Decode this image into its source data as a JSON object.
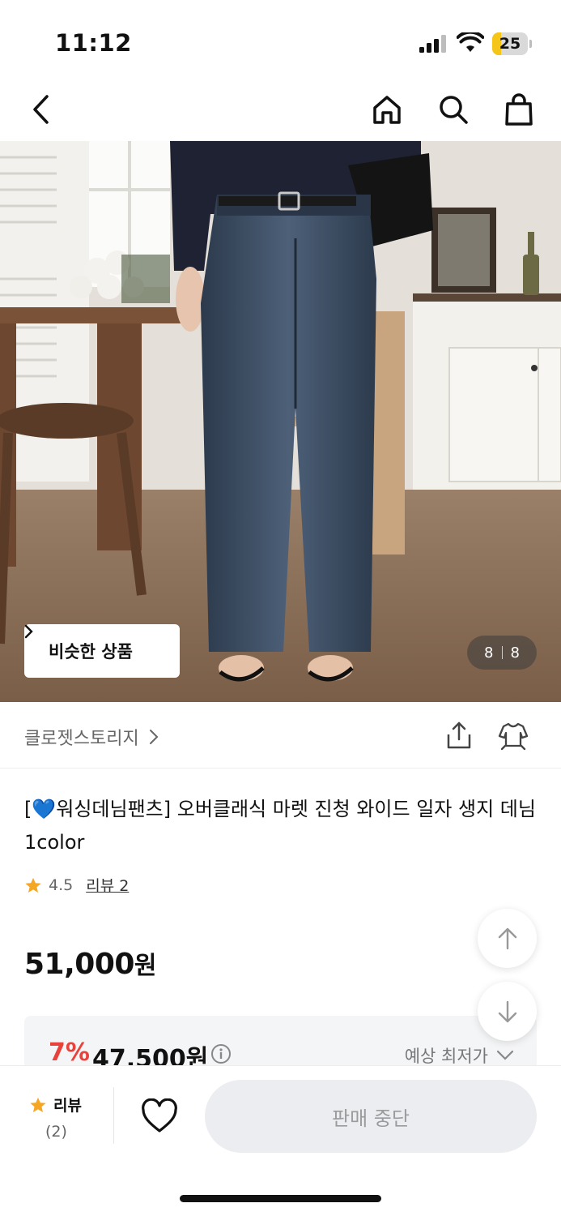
{
  "status": {
    "time": "11:12",
    "battery": "25",
    "battery_level": 0.25
  },
  "nav": {
    "icons": [
      "back-icon",
      "home-icon",
      "search-icon",
      "shopping-bag-icon"
    ]
  },
  "hero": {
    "similar_label": "비슷한 상품",
    "counter": {
      "current": "8",
      "total": "8"
    }
  },
  "brand": {
    "name": "클로젯스토리지"
  },
  "product": {
    "title_prefix": "[",
    "title_emoji": "💙",
    "title_rest": "워싱데님팬츠] 오버클래식 마렛 진청 와이드 일자 생지 데님 1color",
    "rating": "4.5",
    "review_link": "리뷰 2",
    "price": "51,000",
    "price_unit": "원",
    "discount_pct": "7%",
    "discount_price": "47,500원",
    "estimate_label": "예상 최저가"
  },
  "bottom": {
    "review_label": "리뷰",
    "review_count": "(2)",
    "stop_label": "판매 중단"
  },
  "colors": {
    "accent_red": "#e8423a",
    "star": "#f5a623",
    "muted": "#9b9b9b"
  }
}
